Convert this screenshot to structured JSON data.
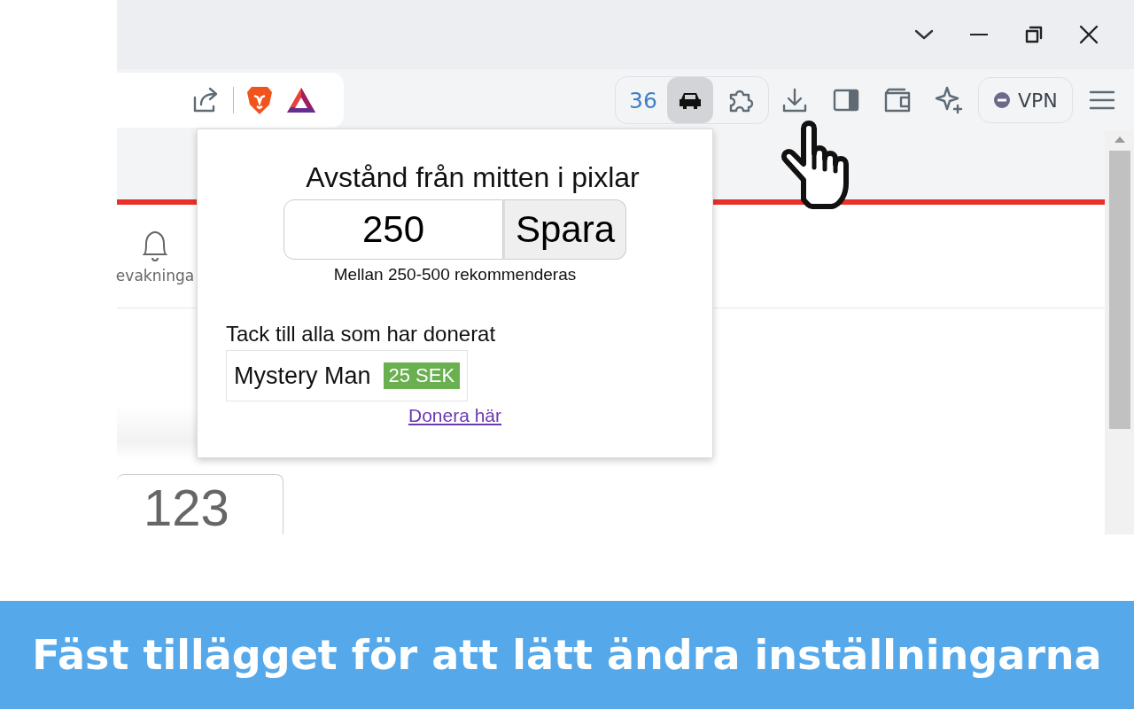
{
  "toolbar": {
    "extensions_count": "36",
    "extensions": [
      {
        "kind": "car",
        "selected": true
      },
      {
        "kind": "puzzle",
        "selected": false
      }
    ],
    "vpn": {
      "label": "VPN"
    }
  },
  "page": {
    "nav_label": "evakninga",
    "plate_text": "123"
  },
  "popup": {
    "title": "Avstånd från mitten i pixlar",
    "value": "250",
    "button": "Spara",
    "hint": "Mellan 250-500 rekommenderas",
    "thanks": "Tack till alla som har donerat",
    "donors": [
      {
        "name": "Mystery Man",
        "amount": "25 SEK"
      }
    ],
    "link": "Donera här"
  },
  "caption": "Fäst tillägget för att lätt ändra inställningarna"
}
